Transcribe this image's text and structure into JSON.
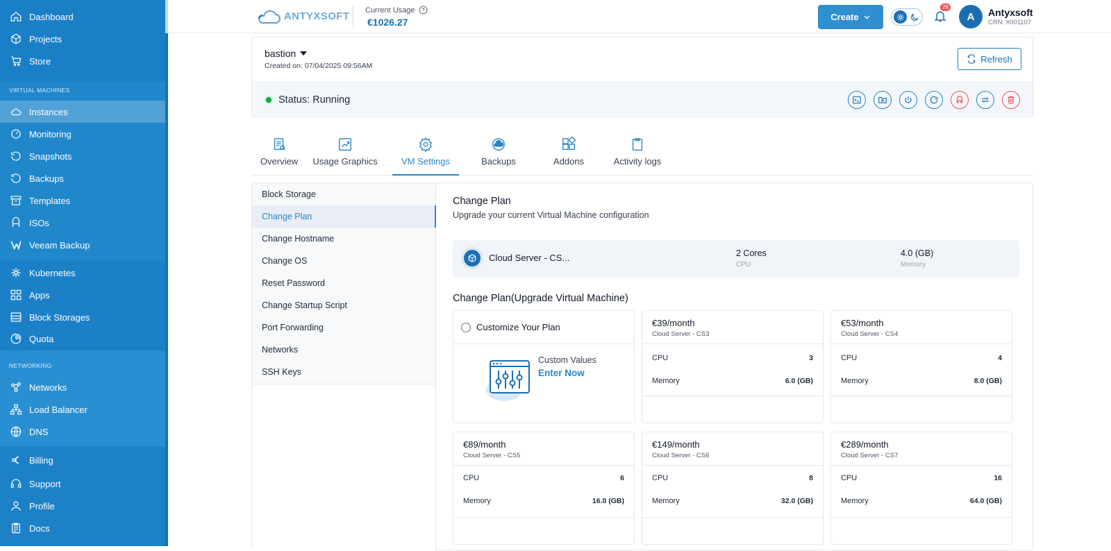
{
  "sidebar": {
    "items": [
      {
        "label": "Dashboard",
        "icon": "home-icon"
      },
      {
        "label": "Projects",
        "icon": "cube-icon"
      },
      {
        "label": "Store",
        "icon": "cart-icon"
      },
      {
        "label": "Instances",
        "icon": "cloud-icon",
        "active": true
      },
      {
        "label": "Monitoring",
        "icon": "gauge-icon"
      },
      {
        "label": "Snapshots",
        "icon": "snapshot-icon"
      },
      {
        "label": "Backups",
        "icon": "history-icon"
      },
      {
        "label": "Templates",
        "icon": "archive-icon"
      },
      {
        "label": "ISOs",
        "icon": "disc-icon"
      },
      {
        "label": "Veeam Backup",
        "icon": "veeam-icon"
      },
      {
        "label": "Kubernetes",
        "icon": "kubernetes-icon"
      },
      {
        "label": "Apps",
        "icon": "apps-icon"
      },
      {
        "label": "Block Storages",
        "icon": "storage-icon"
      },
      {
        "label": "Quota",
        "icon": "pie-icon"
      },
      {
        "label": "Networks",
        "icon": "network-icon"
      },
      {
        "label": "Load Balancer",
        "icon": "balancer-icon"
      },
      {
        "label": "DNS",
        "icon": "globe-icon"
      },
      {
        "label": "Billing",
        "icon": "euro-icon"
      },
      {
        "label": "Support",
        "icon": "headset-icon"
      },
      {
        "label": "Profile",
        "icon": "user-icon"
      },
      {
        "label": "Docs",
        "icon": "doc-icon"
      }
    ],
    "section_vm": "VIRTUAL MACHINES",
    "section_net": "NETWORKING"
  },
  "topbar": {
    "logo": "ANTYXSOFT",
    "usage_label": "Current Usage",
    "usage_value": "€1026.27",
    "create_label": "Create",
    "notif_count": "28",
    "avatar_letter": "A",
    "user_name": "Antyxsoft",
    "crn": "CRN: #001107"
  },
  "vm": {
    "name": "bastion",
    "created": "Created on: 07/04/2025 09:56AM",
    "refresh_label": "Refresh",
    "status": "Status: Running"
  },
  "tabs": [
    {
      "label": "Overview",
      "icon": "overview-icon"
    },
    {
      "label": "Usage Graphics",
      "icon": "chart-icon"
    },
    {
      "label": "VM Settings",
      "icon": "gear-icon",
      "active": true
    },
    {
      "label": "Backups",
      "icon": "backup-icon"
    },
    {
      "label": "Addons",
      "icon": "addons-icon"
    },
    {
      "label": "Activity logs",
      "icon": "clipboard-icon"
    }
  ],
  "submenu": [
    "Block Storage",
    "Change Plan",
    "Change Hostname",
    "Change OS",
    "Reset Password",
    "Change Startup Script",
    "Port Forwarding",
    "Networks",
    "SSH Keys"
  ],
  "change_plan": {
    "title": "Change Plan",
    "subtitle": "Upgrade your current Virtual Machine configuration",
    "current": {
      "name": "Cloud Server - CS...",
      "cpu": "2 Cores",
      "cpu_label": "CPU",
      "memory": "4.0 (GB)",
      "memory_label": "Memory"
    },
    "upgrade_title": "Change Plan(Upgrade Virtual Machine)",
    "custom": {
      "label": "Customize Your Plan",
      "values_label": "Custom Values",
      "link": "Enter Now"
    },
    "cpu_label": "CPU",
    "memory_label": "Memory",
    "plans": [
      {
        "price": "€39/month",
        "name": "Cloud Server - CS3",
        "cpu": "3",
        "memory": "6.0 (GB)"
      },
      {
        "price": "€53/month",
        "name": "Cloud Server - CS4",
        "cpu": "4",
        "memory": "8.0 (GB)"
      },
      {
        "price": "€89/month",
        "name": "Cloud Server - CS5",
        "cpu": "6",
        "memory": "16.0 (GB)"
      },
      {
        "price": "€149/month",
        "name": "Cloud Server - CS6",
        "cpu": "8",
        "memory": "32.0 (GB)"
      },
      {
        "price": "€289/month",
        "name": "Cloud Server - CS7",
        "cpu": "16",
        "memory": "64.0 (GB)"
      }
    ]
  },
  "colors": {
    "primary": "#1a6fb3",
    "accent": "#2a85c6",
    "sidebar": "#1f86cc",
    "danger": "#ef5350",
    "running": "#16a34a"
  }
}
